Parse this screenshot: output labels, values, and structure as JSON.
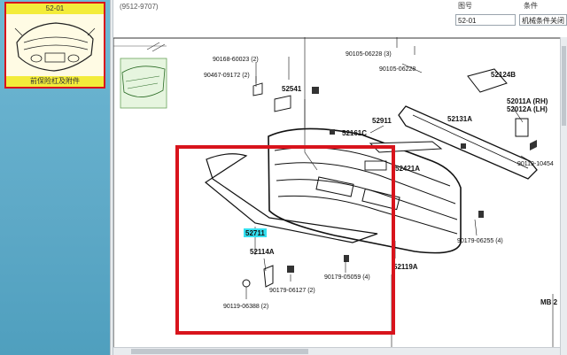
{
  "sidebar": {
    "thumb_code": "52-01",
    "thumb_caption": "前保险杠及附件"
  },
  "header": {
    "subtitle": "(9512-9707)",
    "figure_label": "图号",
    "figure_value": "52-01",
    "condition_label": "条件",
    "condition_value": "机械条件关闭"
  },
  "diagram": {
    "part_numbers": {
      "p90168": "90168-60023 (2)",
      "p90467": "90467-09172 (2)",
      "p52541": "52541",
      "p90105a": "90105-06228 (3)",
      "p90105b": "90105-06228",
      "p52124b": "52124B",
      "p52911": "52911",
      "p52131a": "52131A",
      "p52011a": "52011A (RH)",
      "p52012a": "52012A (LH)",
      "p52161c": "52161C",
      "p52421a": "52421A",
      "p90119a": "90119-10454",
      "p52711": "52711",
      "p52114a": "52114A",
      "p90179a": "90179-05059 (4)",
      "p90179b": "90179-06255 (4)",
      "p90179c": "90179-06127 (2)",
      "p90119b": "90119-06388 (2)",
      "p52119a": "52119A",
      "p_mb": "MB 2"
    },
    "highlight_color": "#d8141c",
    "label_highlight_color": "#35e0f0"
  }
}
